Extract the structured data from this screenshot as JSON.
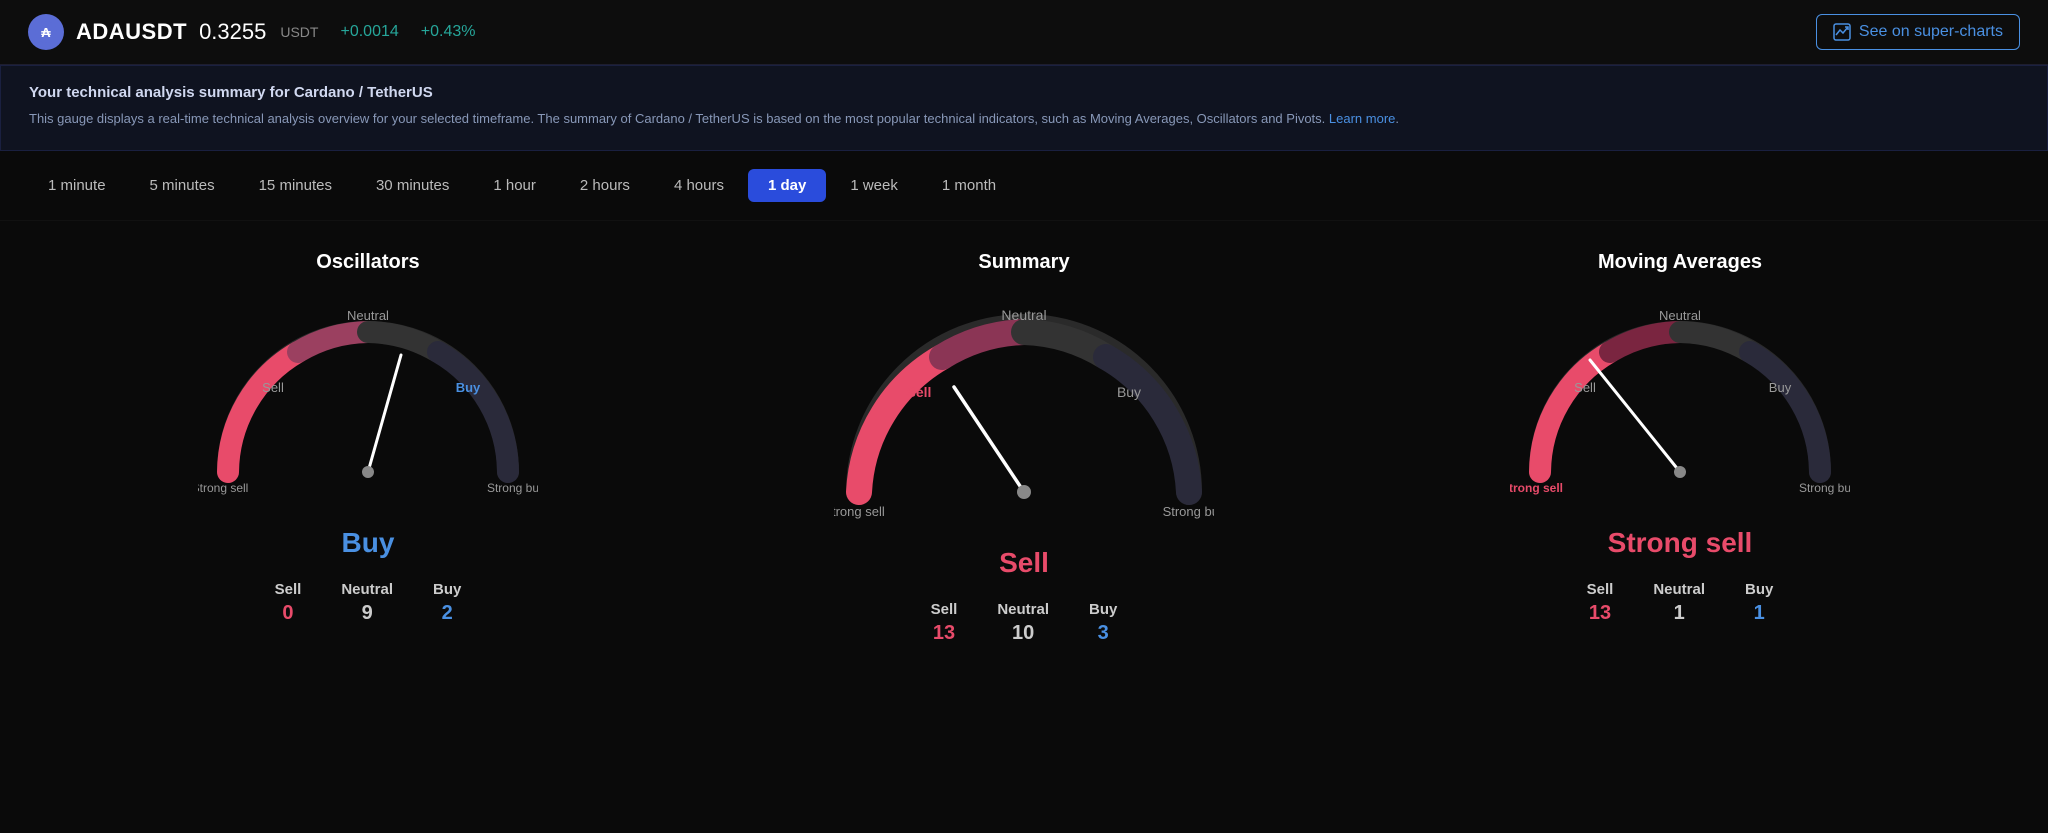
{
  "header": {
    "coin_icon": "₳",
    "ticker": "ADAUSDT",
    "price": "0.3255",
    "price_unit": "USDT",
    "change_abs": "+0.0014",
    "change_pct": "+0.43%",
    "super_charts_label": "See on super-charts"
  },
  "info_banner": {
    "title": "Your technical analysis summary for Cardano / TetherUS",
    "description": "This gauge displays a real-time technical analysis overview for your selected timeframe. The summary of Cardano / TetherUS is based on the most popular technical indicators, such as Moving Averages, Oscillators and Pivots.",
    "learn_more": "Learn more"
  },
  "timeframes": [
    {
      "label": "1 minute",
      "active": false
    },
    {
      "label": "5 minutes",
      "active": false
    },
    {
      "label": "15 minutes",
      "active": false
    },
    {
      "label": "30 minutes",
      "active": false
    },
    {
      "label": "1 hour",
      "active": false
    },
    {
      "label": "2 hours",
      "active": false
    },
    {
      "label": "4 hours",
      "active": false
    },
    {
      "label": "1 day",
      "active": true
    },
    {
      "label": "1 week",
      "active": false
    },
    {
      "label": "1 month",
      "active": false
    }
  ],
  "oscillators": {
    "title": "Oscillators",
    "result": "Buy",
    "result_class": "buy",
    "needle_angle": -15,
    "labels": {
      "strong_sell": "Strong sell",
      "sell": "Sell",
      "neutral": "Neutral",
      "buy": "Buy",
      "strong_buy": "Strong buy"
    },
    "counts": [
      {
        "label": "Sell",
        "value": "0",
        "class": "red"
      },
      {
        "label": "Neutral",
        "value": "9",
        "class": "gray"
      },
      {
        "label": "Buy",
        "value": "2",
        "class": "blue"
      }
    ]
  },
  "summary": {
    "title": "Summary",
    "result": "Sell",
    "result_class": "sell",
    "needle_angle": -45,
    "labels": {
      "strong_sell": "Strong sell",
      "sell": "Sell",
      "neutral": "Neutral",
      "buy": "Buy",
      "strong_buy": "Strong buy"
    },
    "counts": [
      {
        "label": "Sell",
        "value": "13",
        "class": "red"
      },
      {
        "label": "Neutral",
        "value": "10",
        "class": "gray"
      },
      {
        "label": "Buy",
        "value": "3",
        "class": "blue"
      }
    ]
  },
  "moving_averages": {
    "title": "Moving Averages",
    "result": "Strong sell",
    "result_class": "strong-sell",
    "needle_angle": -70,
    "labels": {
      "strong_sell": "Strong sell",
      "sell": "Sell",
      "neutral": "Neutral",
      "buy": "Buy",
      "strong_buy": "Strong buy"
    },
    "counts": [
      {
        "label": "Sell",
        "value": "13",
        "class": "red"
      },
      {
        "label": "Neutral",
        "value": "1",
        "class": "gray"
      },
      {
        "label": "Buy",
        "value": "1",
        "class": "blue"
      }
    ]
  }
}
